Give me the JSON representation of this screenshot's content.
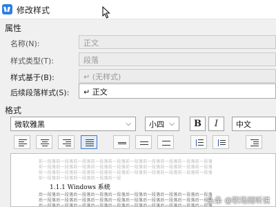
{
  "window": {
    "title": "修改样式",
    "icon": "wps-w-icon"
  },
  "properties": {
    "section_label": "属性",
    "rows": [
      {
        "label": "名称(N):",
        "value": "正文"
      },
      {
        "label": "样式类型(T):",
        "value": "段落"
      },
      {
        "label": "样式基于(B):",
        "value": "↵ (无样式)"
      },
      {
        "label": "后续段落样式(S):",
        "value": "↵ 正文"
      }
    ]
  },
  "format": {
    "section_label": "格式",
    "font": "微软雅黑",
    "size": "小四",
    "bold": "B",
    "italic": "I",
    "script": "中文",
    "toolbar_icons": [
      "align-left-icon",
      "align-center-icon",
      "align-right-icon",
      "justify-icon",
      "single-spacing-icon",
      "one-half-spacing-icon",
      "double-spacing-icon",
      "increase-paragraph-spacing-icon",
      "decrease-paragraph-spacing-icon",
      "indent-icon"
    ]
  },
  "preview": {
    "prev_text": "前一段落前一段落前一段落前一段落前一段落前一段落前一段落前一段落前一段落前一段落",
    "sample": "1.1.1 Windows 系统",
    "next_text": "后一段落后一段落后一段落后一段落后一段落后一段落后一段落后一段落后一段落后一段落"
  },
  "watermark": "头条 @职场雨听说",
  "colors": {
    "accent": "#2f7fe6",
    "selected_border": "#3e78c9"
  }
}
